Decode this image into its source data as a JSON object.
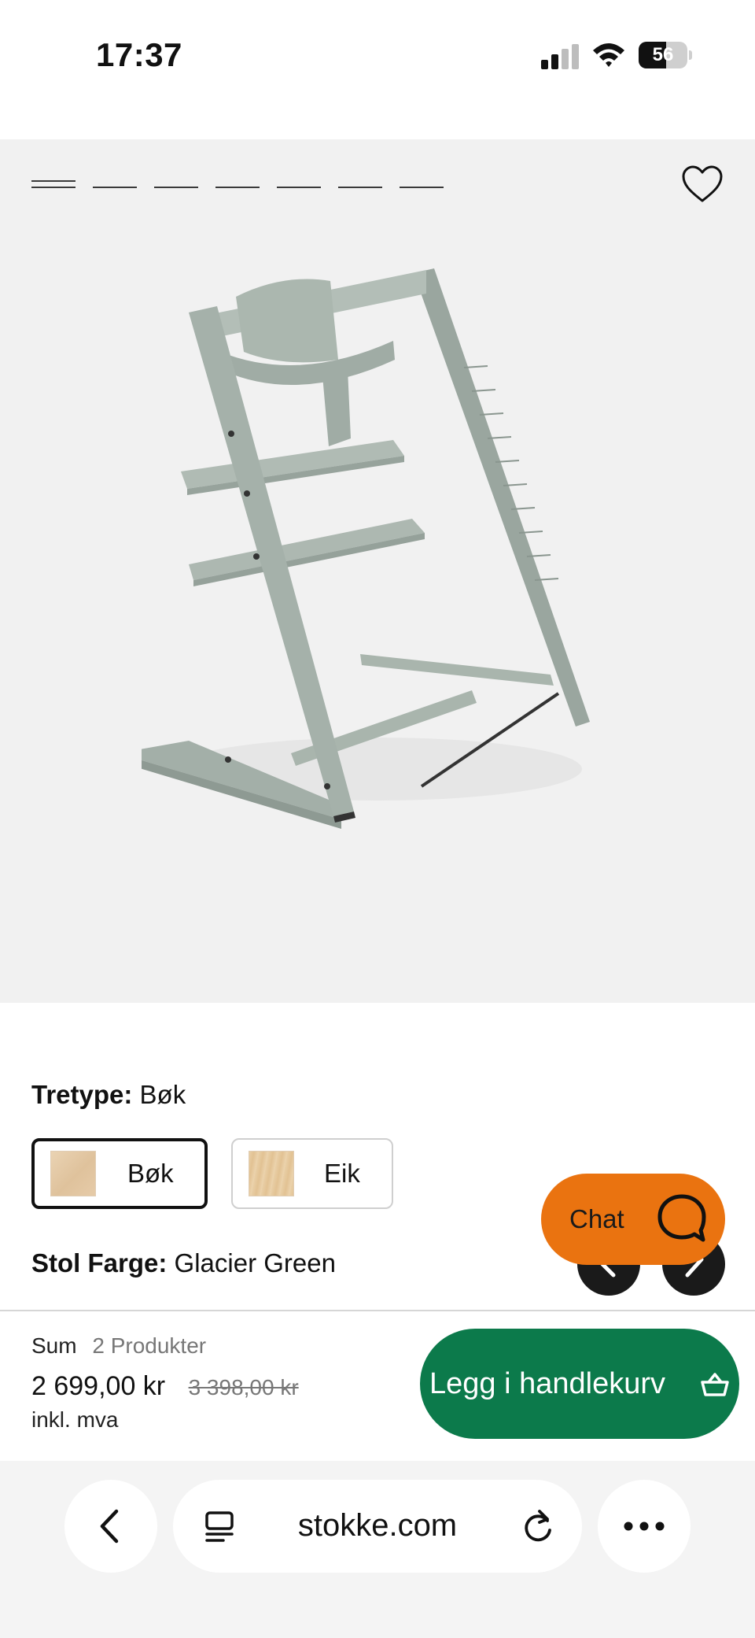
{
  "status_bar": {
    "time": "17:37",
    "battery_level": "56",
    "battery_fraction": 0.56,
    "icons": [
      "cellular-signal-icon",
      "wifi-icon",
      "battery-icon"
    ]
  },
  "gallery": {
    "slide_count": 7,
    "active_slide": 1,
    "image_subject": "chair-image",
    "favorite_icon": "heart-icon",
    "product_color": "#a9b5ad"
  },
  "options": {
    "wood_type_label": "Tretype:",
    "wood_type_value": "Bøk",
    "wood_options": [
      {
        "label": "Bøk",
        "selected": true
      },
      {
        "label": "Eik",
        "selected": false
      }
    ],
    "color_label": "Stol Farge:",
    "color_value": "Glacier Green"
  },
  "chat": {
    "label": "Chat",
    "icon": "chat-bubble-icon",
    "color": "#ea7310"
  },
  "carousel_nav": {
    "prev_icon": "chevron-left-icon",
    "next_icon": "chevron-right-icon"
  },
  "cart": {
    "sum_label": "Sum",
    "product_count": "2 Produkter",
    "price": "2 699,00 kr",
    "original_price": "3 398,00 kr",
    "vat_note": "inkl. mva",
    "add_button_label": "Legg i handlekurv",
    "add_button_icon": "basket-icon",
    "button_color": "#0c7a4b"
  },
  "browser": {
    "url": "stokke.com",
    "icons": [
      "back-icon",
      "reader-icon",
      "reload-icon",
      "more-icon"
    ]
  }
}
